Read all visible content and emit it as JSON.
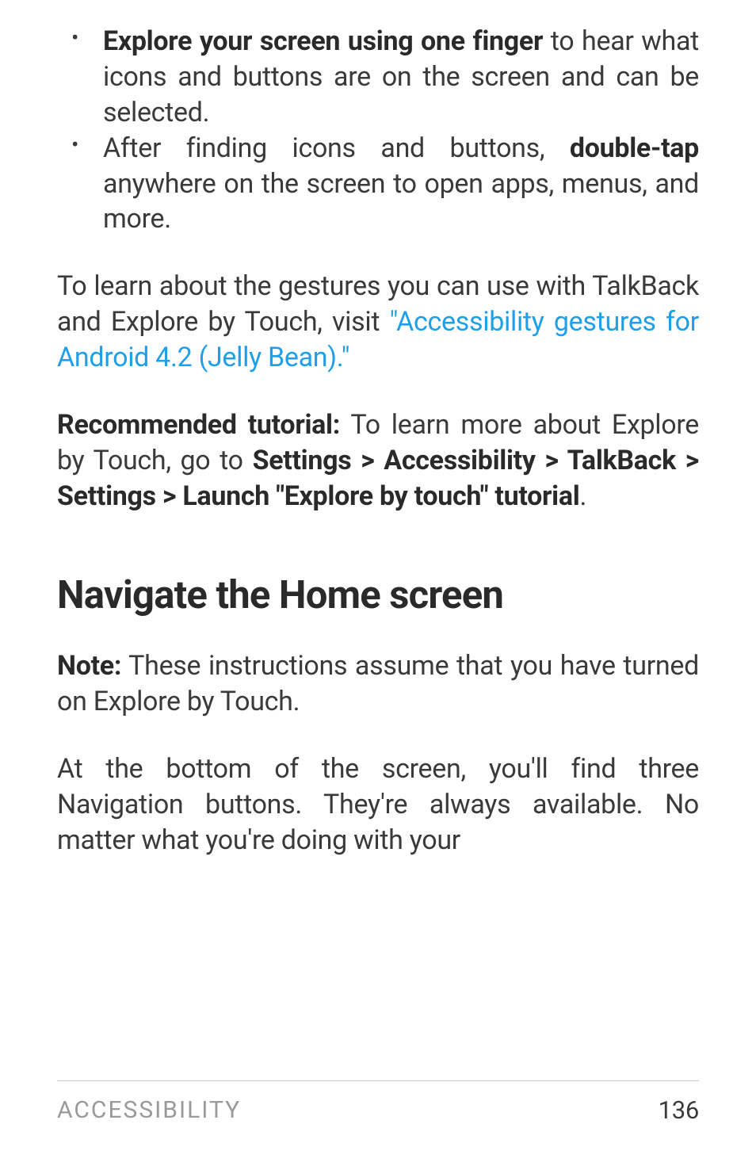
{
  "bullets": [
    {
      "bold1": "Explore your screen using one finger",
      "text1": " to hear what icons and buttons are on the screen and can be selected."
    },
    {
      "text1": "After finding icons and buttons, ",
      "bold1": "double-tap",
      "text2": " anywhere on the screen to open apps, menus, and more."
    }
  ],
  "para1": {
    "text": "To learn about the gestures you can use with TalkBack and Explore by Touch, visit ",
    "link": "\"Acces­sibility gestures for Android 4.2 (Jelly Bean).\""
  },
  "para2": {
    "bold1": "Recommended tutorial:",
    "text1": " To learn more about Explore by Touch, go to ",
    "bold2": "Settings > Acces­sibility > TalkBack > Settings > Launch \"Ex­plore by touch\" tutorial",
    "text2": "."
  },
  "heading": "Navigate the Home screen",
  "para3": {
    "bold1": "Note:",
    "text1": " These instructions assume that you have turned on Explore by Touch."
  },
  "para4": {
    "text": "At the bottom of the screen, you'll find three Navigation buttons. They're always avail­able. No matter what you're doing with your"
  },
  "footer": {
    "section": "ACCESSIBILITY",
    "page": "136"
  }
}
